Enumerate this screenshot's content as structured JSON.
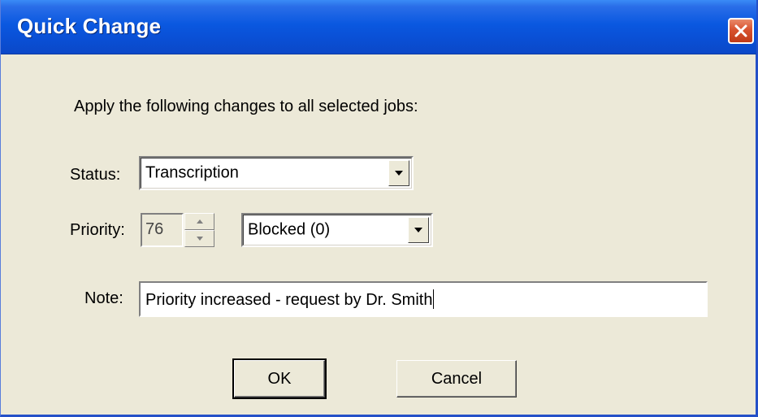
{
  "window": {
    "title": "Quick Change"
  },
  "instruction": "Apply the following changes to all selected jobs:",
  "status": {
    "label": "Status:",
    "value": "Transcription"
  },
  "priority": {
    "label": "Priority:",
    "value": "76",
    "level_value": "Blocked (0)"
  },
  "note": {
    "label": "Note:",
    "value": "Priority increased - request by Dr. Smith"
  },
  "buttons": {
    "ok": "OK",
    "cancel": "Cancel"
  },
  "colors": {
    "titlebar": "#0a58e0",
    "close": "#d8522f",
    "face": "#ece9d8"
  },
  "icons": [
    "close-icon",
    "dropdown-arrow-icon",
    "spin-up-icon",
    "spin-down-icon"
  ]
}
